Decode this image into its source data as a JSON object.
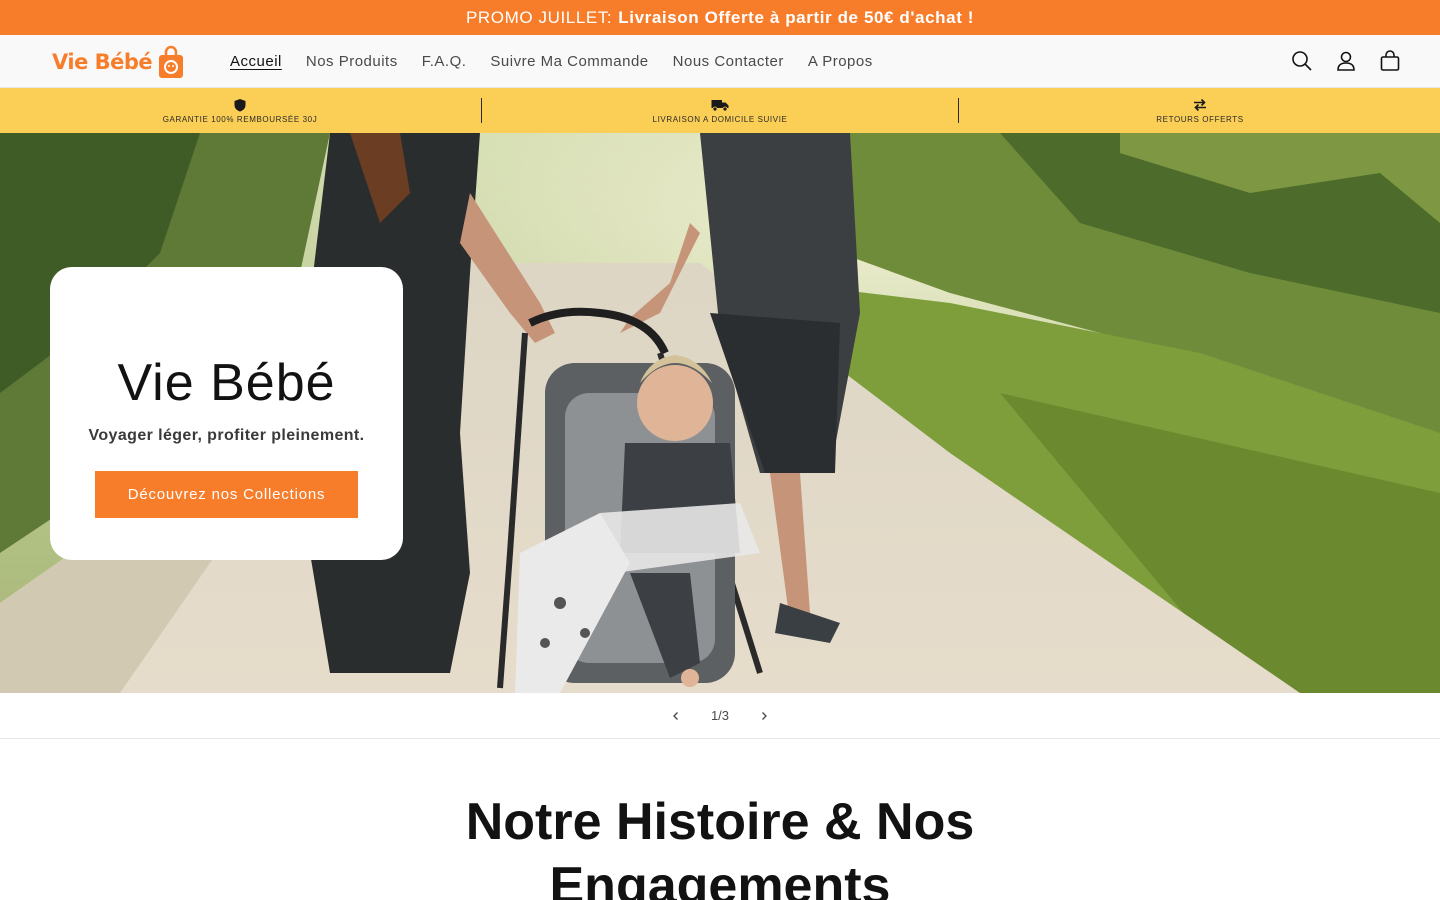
{
  "promo": {
    "prefix": "PROMO JUILLET:",
    "highlight": "Livraison Offerte à partir de 50€ d'achat !"
  },
  "header": {
    "logo_text": "Vie Bébé",
    "nav": [
      {
        "label": "Accueil",
        "active": true
      },
      {
        "label": "Nos Produits"
      },
      {
        "label": "F.A.Q."
      },
      {
        "label": "Suivre Ma Commande"
      },
      {
        "label": "Nous Contacter"
      },
      {
        "label": "A Propos"
      }
    ],
    "icons": [
      "search-icon",
      "account-icon",
      "cart-icon"
    ]
  },
  "trust_bar": [
    {
      "icon": "shield-icon",
      "label": "GARANTIE 100% REMBOURSÉE 30J"
    },
    {
      "icon": "truck-icon",
      "label": "LIVRAISON A DOMICILE SUIVIE"
    },
    {
      "icon": "exchange-icon",
      "label": "RETOURS OFFERTS"
    }
  ],
  "hero": {
    "title": "Vie Bébé",
    "subtitle": "Voyager léger, profiter pleinement.",
    "button": "Découvrez nos Collections"
  },
  "slider": {
    "counter": "1/3"
  },
  "story": {
    "title_line1": "Notre Histoire & Nos",
    "title_line2": "Engagements"
  },
  "colors": {
    "accent": "#f87d2b",
    "trust_bg": "#fbcf56"
  }
}
